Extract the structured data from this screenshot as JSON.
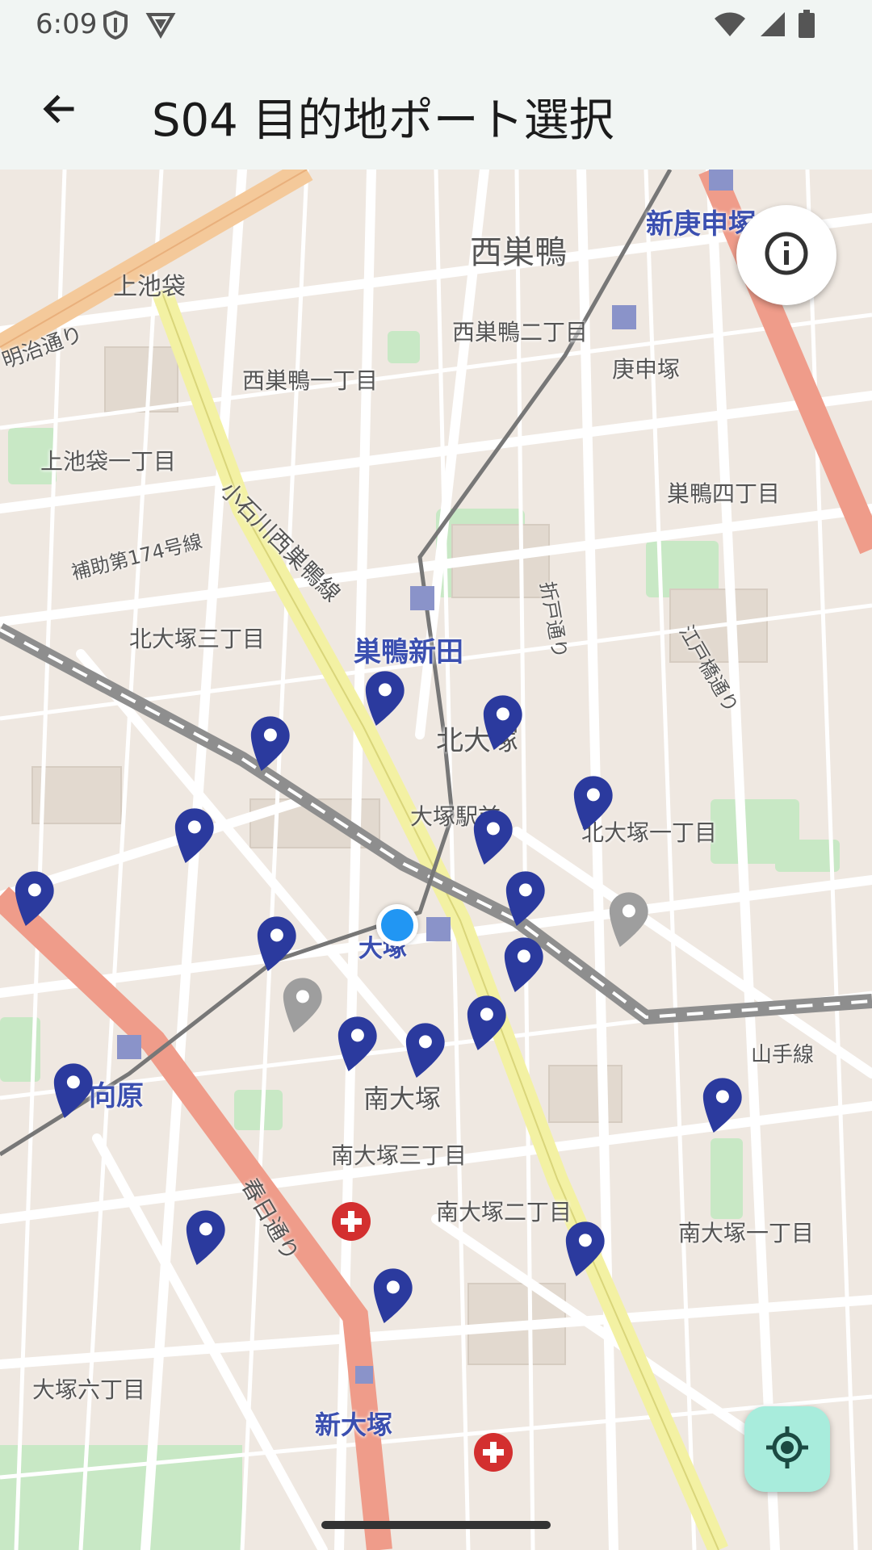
{
  "status_bar": {
    "time": "6:09",
    "left_icons": [
      "shield-icon",
      "vpn-triangle-icon"
    ],
    "right_icons": [
      "wifi-icon",
      "cellular-signal-icon",
      "battery-icon"
    ]
  },
  "app_bar": {
    "back_icon": "arrow-back-icon",
    "title": "S04 目的地ポート選択"
  },
  "map": {
    "district_labels": [
      {
        "id": "nishisugamo",
        "text": "西巣鴨"
      },
      {
        "id": "nishisugamo-2",
        "text": "西巣鴨二丁目"
      },
      {
        "id": "nishisugamo-1",
        "text": "西巣鴨一丁目"
      },
      {
        "id": "koshinzuka",
        "text": "庚申塚"
      },
      {
        "id": "kamiikebukuro",
        "text": "上池袋"
      },
      {
        "id": "kamiikebukuro-1",
        "text": "上池袋一丁目"
      },
      {
        "id": "sugamo-4",
        "text": "巣鴨四丁目"
      },
      {
        "id": "kitaotsuka-3",
        "text": "北大塚三丁目"
      },
      {
        "id": "kitaotsuka",
        "text": "北大塚"
      },
      {
        "id": "kitaotsuka-1",
        "text": "北大塚一丁目"
      },
      {
        "id": "minamiotsuka",
        "text": "南大塚"
      },
      {
        "id": "minamiotsuka-3",
        "text": "南大塚三丁目"
      },
      {
        "id": "minamiotsuka-2",
        "text": "南大塚二丁目"
      },
      {
        "id": "minamiotsuka-1",
        "text": "南大塚一丁目"
      },
      {
        "id": "otsuka-6",
        "text": "大塚六丁目"
      },
      {
        "id": "otsuka-ekimae",
        "text": "大塚駅前"
      }
    ],
    "road_labels": [
      {
        "id": "meiji-dori",
        "text": "明治通り"
      },
      {
        "id": "koishikawa-nishi-sugamo",
        "text": "小石川西巣鴨線"
      },
      {
        "id": "hojo-174",
        "text": "補助第174号線"
      },
      {
        "id": "orido-dori",
        "text": "折戸通り"
      },
      {
        "id": "edo-yokocho",
        "text": "江戸橋通り"
      },
      {
        "id": "kasuga-dori",
        "text": "春日通り"
      },
      {
        "id": "yamanote-line",
        "text": "山手線"
      }
    ],
    "station_labels": [
      {
        "id": "sugamo-shinden",
        "text": "巣鴨新田"
      },
      {
        "id": "shin-koshinzuka",
        "text": "新庚申塚"
      },
      {
        "id": "mukohara",
        "text": "向原"
      },
      {
        "id": "shin-otsuka",
        "text": "新大塚"
      },
      {
        "id": "otsuka",
        "text": "大塚"
      }
    ],
    "port_markers": [
      {
        "status": "available"
      },
      {
        "status": "available"
      },
      {
        "status": "available"
      },
      {
        "status": "available"
      },
      {
        "status": "available"
      },
      {
        "status": "available"
      },
      {
        "status": "available"
      },
      {
        "status": "available"
      },
      {
        "status": "available"
      },
      {
        "status": "available"
      },
      {
        "status": "available"
      },
      {
        "status": "available"
      },
      {
        "status": "available"
      },
      {
        "status": "available"
      },
      {
        "status": "available"
      },
      {
        "status": "available"
      },
      {
        "status": "available"
      },
      {
        "status": "available"
      },
      {
        "status": "unavailable"
      },
      {
        "status": "unavailable"
      }
    ],
    "hospital_markers": 2,
    "my_location": "current-location-dot"
  },
  "controls": {
    "info_icon": "info-icon",
    "locate_icon": "my-location-icon"
  },
  "colors": {
    "marker_available": "#2b3a9e",
    "marker_unavailable": "#9e9e9e",
    "current_location": "#2196f3",
    "locate_button_bg": "#a8ecdc",
    "hospital": "#d32f2f"
  }
}
